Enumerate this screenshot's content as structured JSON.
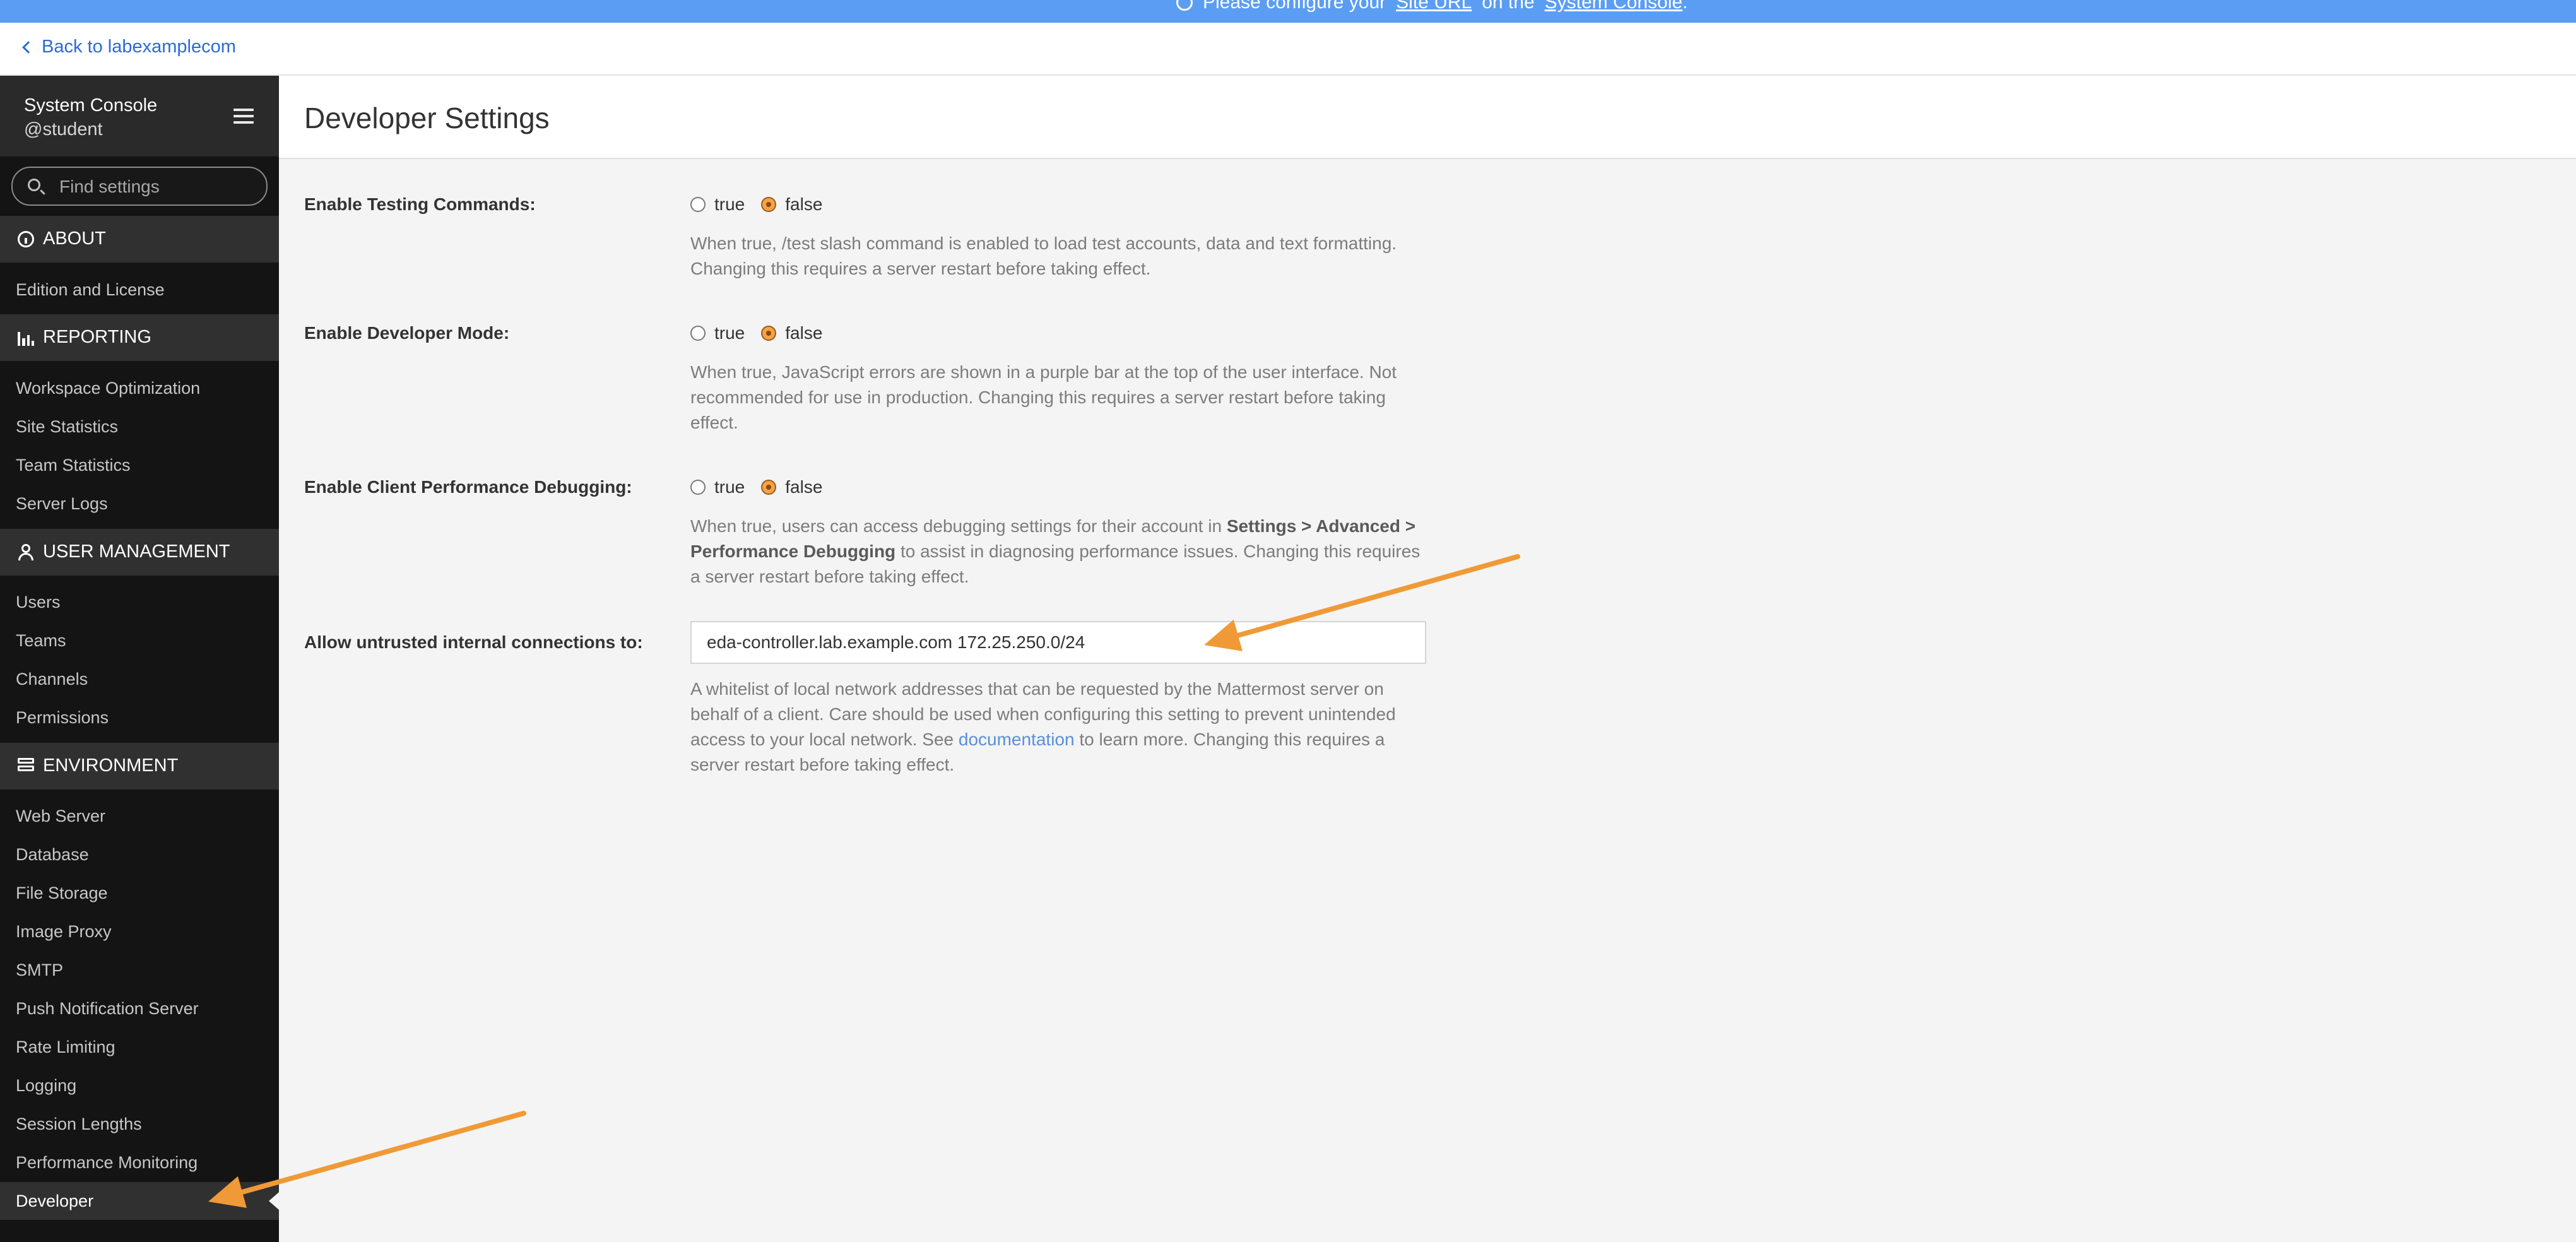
{
  "banner": {
    "text_pre": "Please configure your",
    "link1": "Site URL",
    "text_mid": "on the",
    "link2": "System Console",
    "text_post": "."
  },
  "back_link": {
    "label": "Back to labexamplecom"
  },
  "sidebar": {
    "title": "System Console",
    "user": "@student",
    "search_placeholder": "Find settings",
    "sections": {
      "about": {
        "label": "ABOUT",
        "icon": "info-icon",
        "items": [
          "Edition and License"
        ]
      },
      "reporting": {
        "label": "REPORTING",
        "icon": "bar-chart-icon",
        "items": [
          "Workspace Optimization",
          "Site Statistics",
          "Team Statistics",
          "Server Logs"
        ]
      },
      "user_management": {
        "label": "USER MANAGEMENT",
        "icon": "users-icon",
        "items": [
          "Users",
          "Teams",
          "Channels",
          "Permissions"
        ]
      },
      "environment": {
        "label": "ENVIRONMENT",
        "icon": "server-icon",
        "items": [
          "Web Server",
          "Database",
          "File Storage",
          "Image Proxy",
          "SMTP",
          "Push Notification Server",
          "Rate Limiting",
          "Logging",
          "Session Lengths",
          "Performance Monitoring",
          "Developer"
        ]
      }
    },
    "active_item": "Developer"
  },
  "page": {
    "title": "Developer Settings"
  },
  "settings": [
    {
      "label": "Enable Testing Commands:",
      "true_label": "true",
      "false_label": "false",
      "selected": "false",
      "help": "When true, /test slash command is enabled to load test accounts, data and text formatting. Changing this requires a server restart before taking effect."
    },
    {
      "label": "Enable Developer Mode:",
      "true_label": "true",
      "false_label": "false",
      "selected": "false",
      "help": "When true, JavaScript errors are shown in a purple bar at the top of the user interface. Not recommended for use in production. Changing this requires a server restart before taking effect."
    },
    {
      "label": "Enable Client Performance Debugging:",
      "true_label": "true",
      "false_label": "false",
      "selected": "false",
      "help_pre": "When true, users can access debugging settings for their account in",
      "help_bold": "Settings > Advanced > Performance Debugging",
      "help_post": "to assist in diagnosing performance issues. Changing this requires a server restart before taking effect."
    },
    {
      "label": "Allow untrusted internal connections to:",
      "value": "eda-controller.lab.example.com 172.25.250.0/24",
      "help_pre": "A whitelist of local network addresses that can be requested by the Mattermost server on behalf of a client. Care should be used when configuring this setting to prevent unintended access to your local network. See",
      "help_link": "documentation",
      "help_post": "to learn more. Changing this requires a server restart before taking effect."
    }
  ],
  "annotation": {
    "arrow_color": "#f09a37"
  }
}
